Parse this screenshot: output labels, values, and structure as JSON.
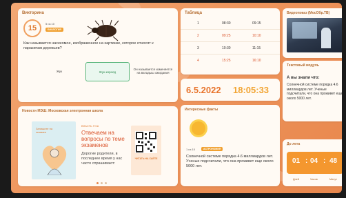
{
  "quiz": {
    "title": "Викторина",
    "timer": "15",
    "tag_small": "5 из 10",
    "tag_label": "БИОЛОГИЯ",
    "question": "Как называется насекомое, изображенное на картинке, которое относят к паразитам деревьев?",
    "answers": [
      "Жук",
      "Жук-короед",
      "Он называется изменяется на вкладыш ожидания"
    ]
  },
  "table": {
    "title": "Таблица",
    "rows": [
      {
        "n": "1",
        "start": "08:30",
        "end": "09:15"
      },
      {
        "n": "2",
        "start": "09:25",
        "end": "10:10"
      },
      {
        "n": "3",
        "start": "10:30",
        "end": "11:15"
      },
      {
        "n": "4",
        "start": "15:25",
        "end": "16:10"
      }
    ]
  },
  "datetime": {
    "date": "6.5.2022",
    "time": "18:05:33"
  },
  "video": {
    "title": "Видеопоказ (МосОбр.ТВ)"
  },
  "text_module": {
    "title": "Текстовый модуль",
    "heading": "А вы знали что:",
    "body": "Солнечной системе порядка 4.6 миллиардов лет. Ученые подсчитали, что она проживет еще около 5000 лет."
  },
  "news": {
    "title": "Новости МЭШ: Московская электронная школа",
    "tag": "ВЛАСТЬ ГУШ",
    "headline": "Отвечаем на вопросы по теме экзаменов",
    "body": "Дорогие родители, в последнее время у нас часто спрашивают:",
    "qr_caption": "ЧИТАТЬ НА САЙТЕ",
    "card_text": "Запишите на экзамен"
  },
  "facts": {
    "title": "Интересные факты",
    "tag_small": "1 из 10",
    "tag_label": "АСТРОНОМИЯ",
    "text": "Солнечной системе порядка 4.6 миллиардов лет. Ученые подсчитали, что она проживет еще около 5000 лет."
  },
  "countdown": {
    "title": "До лета",
    "days": "01",
    "hours": "04",
    "minutes": "48",
    "labels": {
      "days": "Дней",
      "hours": "Часов",
      "minutes": "Минут"
    }
  }
}
